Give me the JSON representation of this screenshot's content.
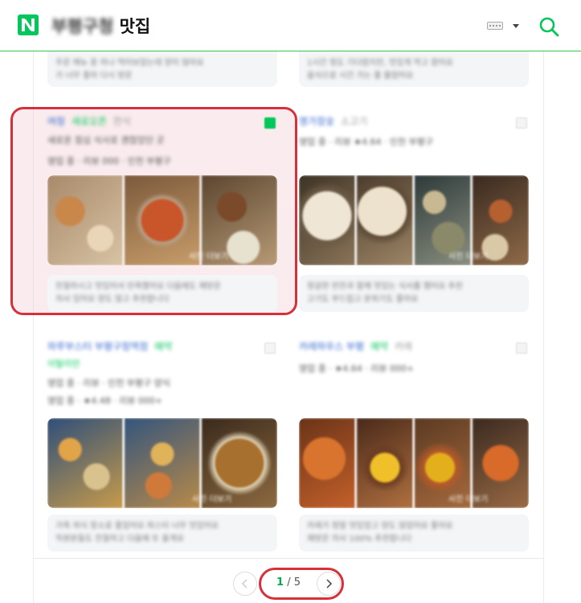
{
  "header": {
    "query_blurred": "부평구청",
    "query_visible": "맛집",
    "logo_letter": "N"
  },
  "colors": {
    "brand_green": "#03c75a",
    "highlight_red": "#d6303a",
    "link_blue": "#3366cc"
  },
  "icons": [
    "naver-logo-icon",
    "keyboard-icon",
    "dropdown-caret-icon",
    "search-icon",
    "prev-arrow-icon",
    "next-arrow-icon",
    "bookmark-icon"
  ],
  "top_reviews": [
    {
      "lines": [
        "주문 메뉴 중 하나 먹어보았는데 양이 많아요",
        "가 너무 좋아 다시 방문"
      ]
    },
    {
      "lines": [
        "1시간 정도 기다렸지만, 맛있게 먹고 왔어요",
        "음식으로 시간 가는 줄 몰랐어요"
      ]
    }
  ],
  "cards": [
    {
      "name": "여청",
      "badge": "새로오픈",
      "category": "한식",
      "line1": "새로운 점심 식사로 괜찮았던 곳",
      "line2": "영업 중 · 리뷰 000 · 인천 부평구",
      "review": [
        "친절하시고 맛있어서 만족했어요 다음에도 재방문",
        "의사 있어요 양도 많고 추천합니다"
      ],
      "photo_tag": "사진 더보기"
    },
    {
      "name": "명가참숯",
      "badge": "",
      "category": "소고기",
      "line1": "영업 중 · 리뷰 ★4.64 · 인천 부평구",
      "line2": "",
      "review": [
        "정갈한 반찬과 함께 맛있는 식사를 했어요 추천",
        "고기도 부드럽고 분위기도 좋아요"
      ],
      "photo_tag": "사진 더보기"
    },
    {
      "name": "하루부스터 부평구청역점",
      "badge": "예약",
      "category": "이탈리안",
      "line1": "영업 중 · 리뷰 · 인천 부평구 양식",
      "line2": "영업 중 · ★4.48 · 리뷰 000+",
      "review": [
        "가족 외식 장소로 좋았어요 파스타 너무 맛있어요",
        "직원분들도 친절하고 다음에 또 올게요"
      ],
      "photo_tag": "사진 더보기"
    },
    {
      "name": "카레하우스 부평",
      "badge": "예약",
      "category": "카레",
      "line1": "영업 중 · ★4.64 · 리뷰 000+",
      "line2": "",
      "review": [
        "카레가 정말 맛있었고 양도 많았어요 좋아요",
        "재방문 의사 100% 추천합니다"
      ],
      "photo_tag": "사진 더보기"
    }
  ],
  "pagination": {
    "current": "1",
    "separator": "/",
    "total": "5"
  }
}
